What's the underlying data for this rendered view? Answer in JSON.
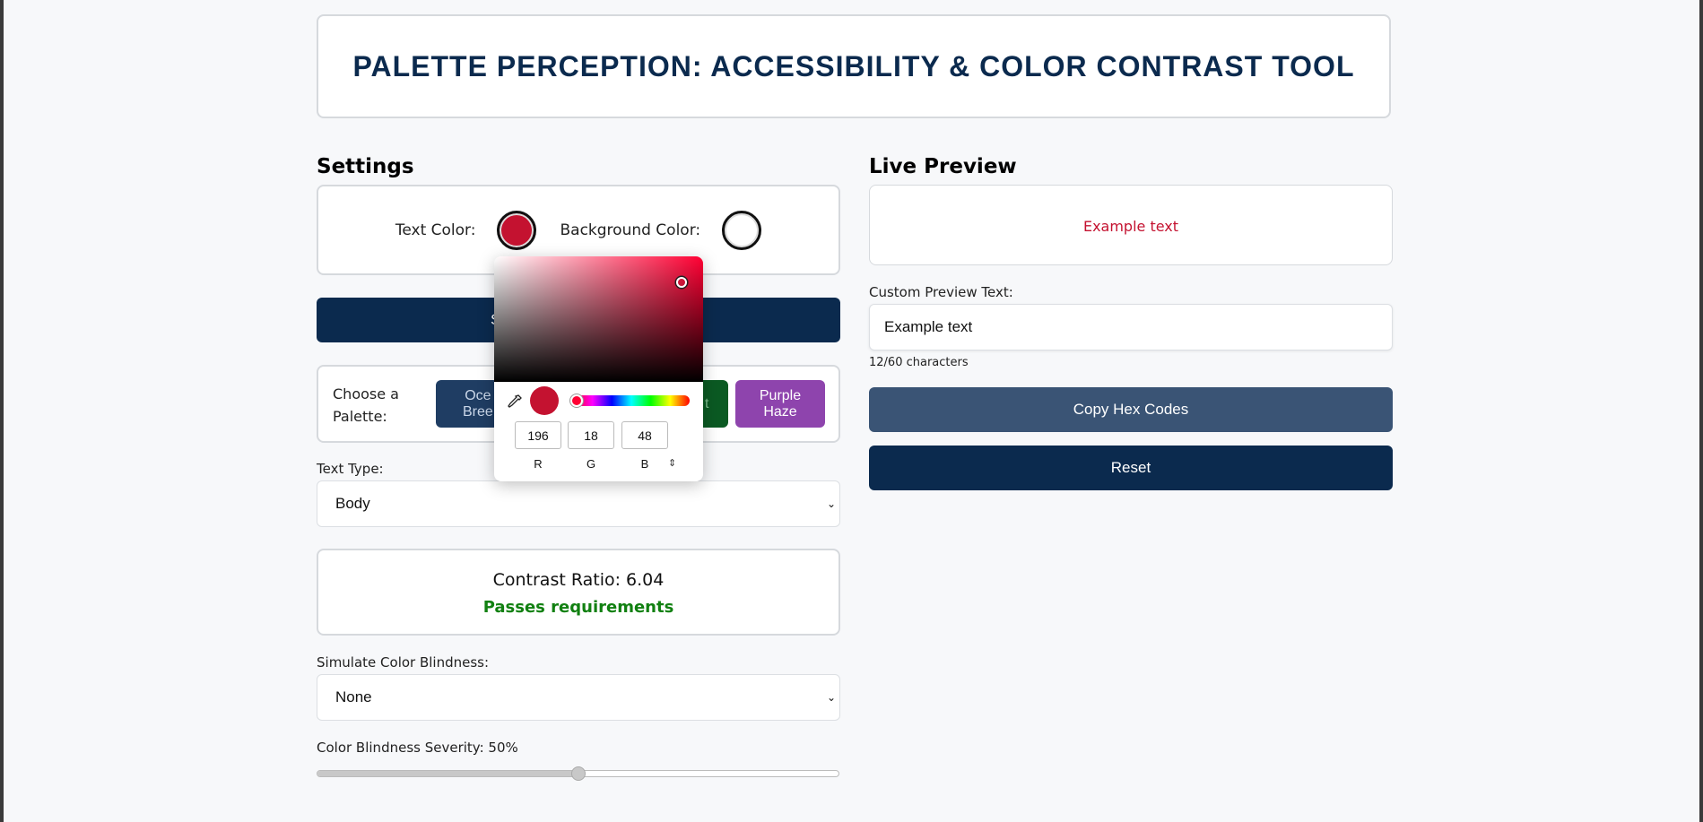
{
  "header": {
    "title": "PALETTE PERCEPTION: ACCESSIBILITY & COLOR CONTRAST TOOL"
  },
  "settings": {
    "title": "Settings",
    "text_color_label": "Text Color:",
    "background_color_label": "Background Color:",
    "text_color": "#c41230",
    "background_color": "#ffffff",
    "primary_button_label": "S",
    "palette_label": "Choose a Palette:",
    "palettes": [
      {
        "label": "Ocean Breeze",
        "visible_text": "Oce\nBree",
        "color": "#1f3d63"
      },
      {
        "label": "",
        "visible_text": "t",
        "color": "#0b5a23"
      },
      {
        "label": "Purple Haze",
        "visible_text": "Purple\nHaze",
        "color": "#8e44ad"
      }
    ],
    "text_type_label": "Text Type:",
    "text_type_value": "Body",
    "contrast_ratio_text": "Contrast Ratio: 6.04",
    "contrast_status": "Passes requirements",
    "simulate_label": "Simulate Color Blindness:",
    "simulate_value": "None",
    "severity_label": "Color Blindness Severity: 50%",
    "severity_value": 0.5
  },
  "color_picker": {
    "r": "196",
    "g": "18",
    "b": "48",
    "r_label": "R",
    "g_label": "G",
    "b_label": "B",
    "current_color": "#c41230"
  },
  "preview": {
    "title": "Live Preview",
    "sample_text": "Example text",
    "custom_label": "Custom Preview Text:",
    "custom_value": "Example text",
    "char_count": "12/60 characters",
    "copy_button": "Copy Hex Codes",
    "reset_button": "Reset"
  },
  "colors": {
    "navy": "#0b2a4e",
    "slate_button": "#3a5475",
    "pass_green": "#118011"
  }
}
